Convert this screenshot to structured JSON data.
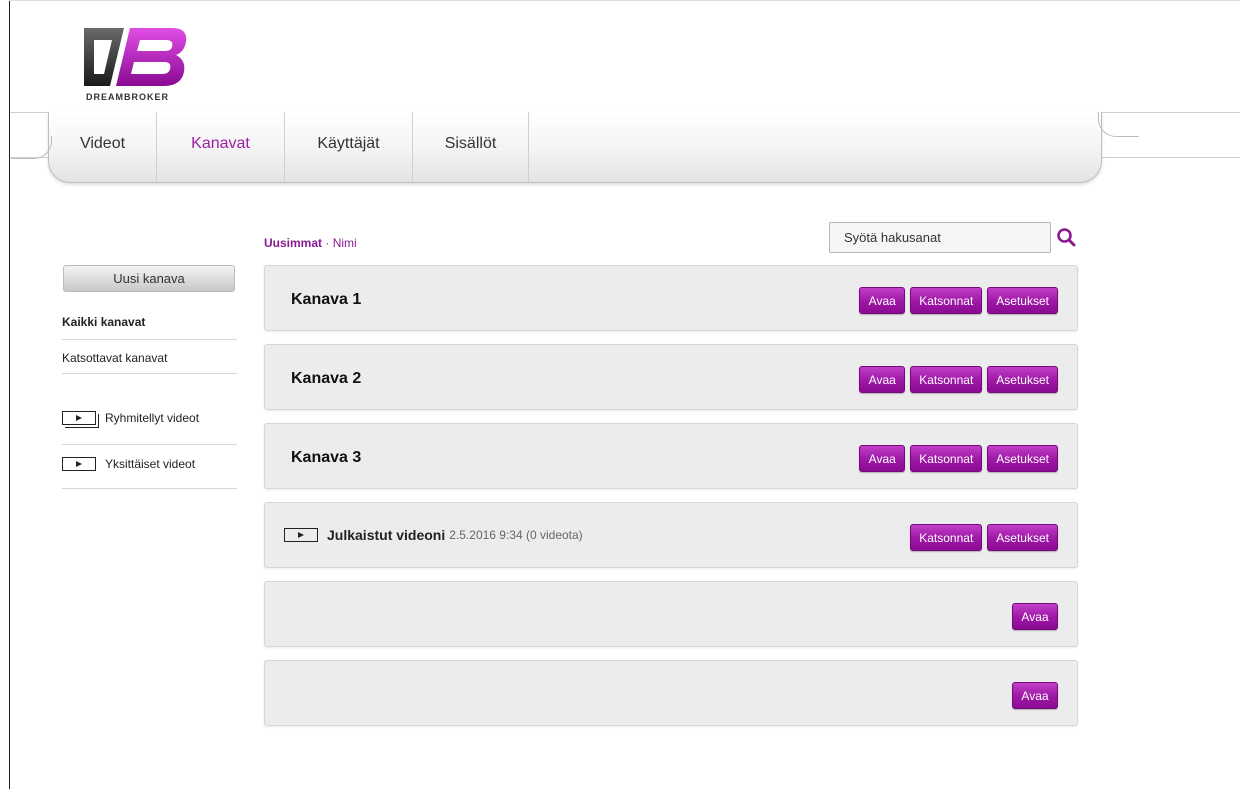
{
  "brand": {
    "name": "DREAMBROKER"
  },
  "nav": {
    "items": [
      {
        "label": "Videot"
      },
      {
        "label": "Kanavat"
      },
      {
        "label": "Käyttäjät"
      },
      {
        "label": "Sisällöt"
      }
    ],
    "active_index": 1
  },
  "sidebar": {
    "new_channel": "Uusi kanava",
    "all_channels": "Kaikki kanavat",
    "watched_channels": "Katsottavat kanavat",
    "grouped_videos": "Ryhmitellyt videot",
    "single_videos": "Yksittäiset videot"
  },
  "sort": {
    "newest": "Uusimmat",
    "separator": " · ",
    "name": "Nimi"
  },
  "search": {
    "placeholder": "Syötä hakusanat"
  },
  "cards": [
    {
      "title": "Kanava 1",
      "buttons": [
        "Avaa",
        "Katsonnat",
        "Asetukset"
      ]
    },
    {
      "title": "Kanava 2",
      "buttons": [
        "Avaa",
        "Katsonnat",
        "Asetukset"
      ]
    },
    {
      "title": "Kanava 3",
      "buttons": [
        "Avaa",
        "Katsonnat",
        "Asetukset"
      ]
    },
    {
      "title": "Julkaistut videoni",
      "meta": "2.5.2016 9:34 (0 videota)",
      "buttons": [
        "Katsonnat",
        "Asetukset"
      ]
    },
    {
      "title": "",
      "buttons": [
        "Avaa"
      ]
    },
    {
      "title": "",
      "buttons": [
        "Avaa"
      ]
    }
  ],
  "colors": {
    "accent": "#9c20a4",
    "button": "#a01aa8"
  }
}
